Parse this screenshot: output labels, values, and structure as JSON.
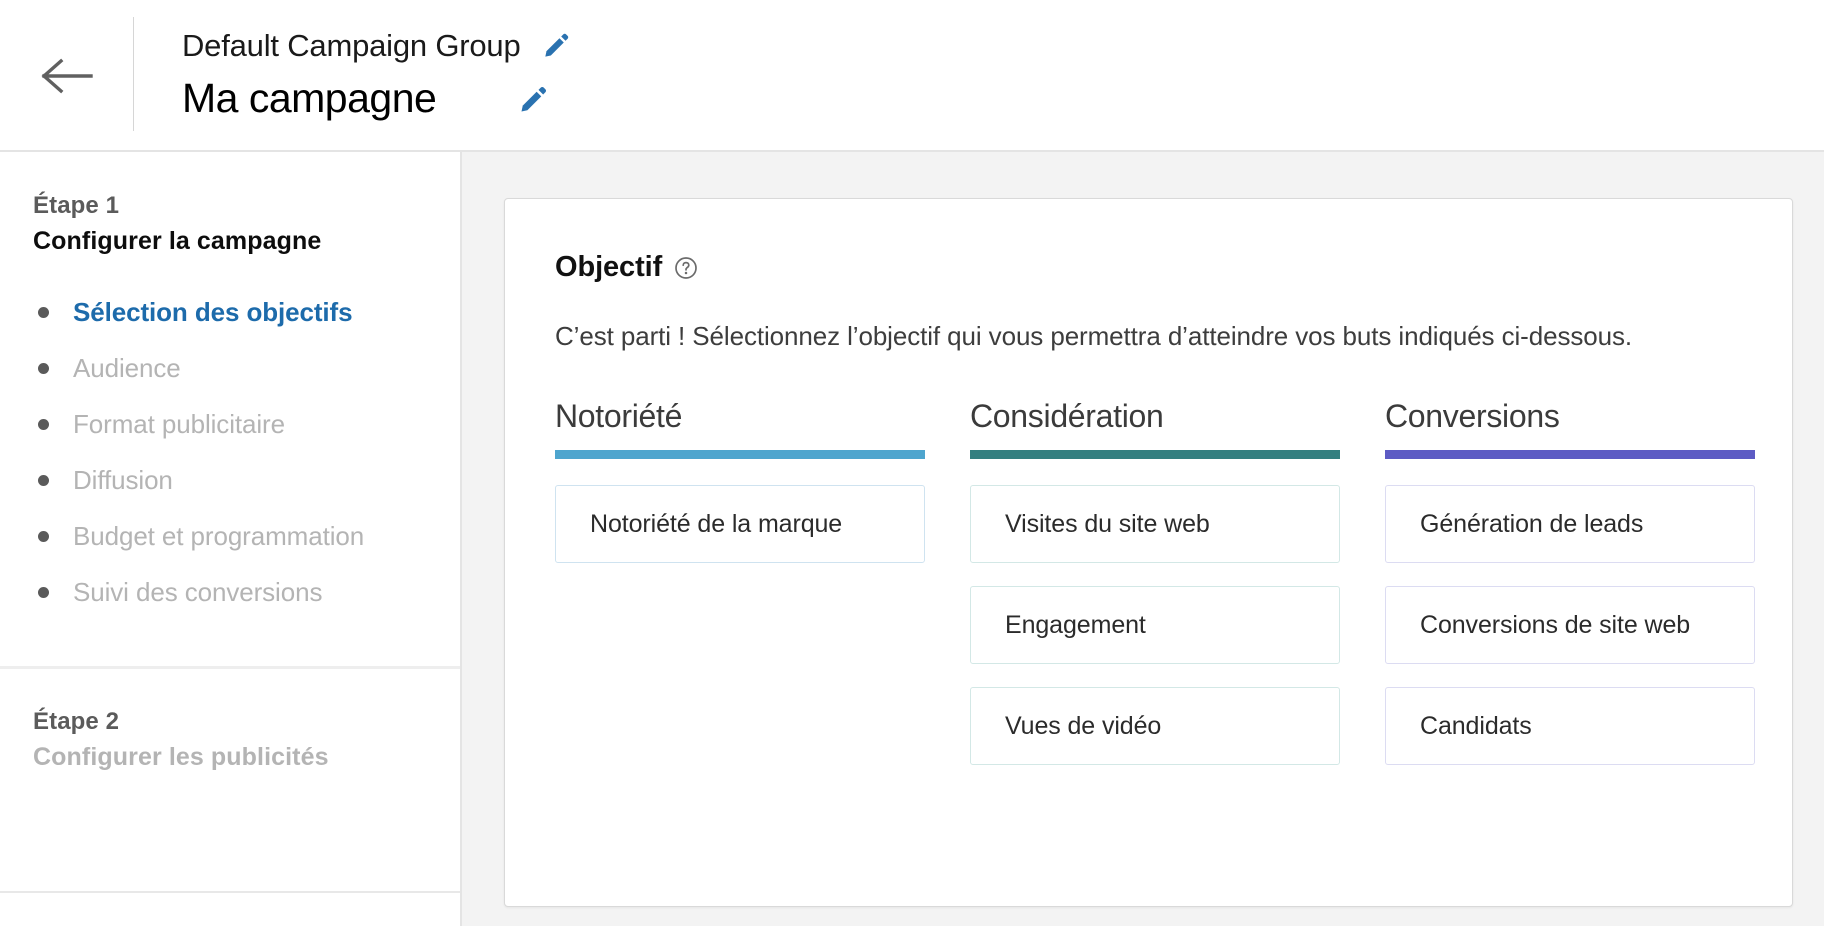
{
  "header": {
    "back_icon": "arrow-left-icon",
    "group_name": "Default Campaign Group",
    "group_edit_icon": "pencil-icon",
    "campaign_name": "Ma campagne",
    "campaign_edit_icon": "pencil-icon",
    "accent_color": "#2a72b0"
  },
  "sidebar": {
    "step1": {
      "label": "Étape 1",
      "title": "Configurer la campagne",
      "substeps": [
        {
          "label": "Sélection des objectifs",
          "active": true
        },
        {
          "label": "Audience",
          "active": false
        },
        {
          "label": "Format publicitaire",
          "active": false
        },
        {
          "label": "Diffusion",
          "active": false
        },
        {
          "label": "Budget et programmation",
          "active": false
        },
        {
          "label": "Suivi des conversions",
          "active": false
        }
      ]
    },
    "step2": {
      "label": "Étape 2",
      "title": "Configurer les publicités"
    },
    "active_color": "#1d6bab",
    "muted_color": "#b4b4b4"
  },
  "main": {
    "card_title": "Objectif",
    "help_icon": "help-circle-icon",
    "description": "C’est parti ! Sélectionnez l’objectif qui vous permettra d’atteindre vos buts indiqués ci-dessous.",
    "columns": [
      {
        "title": "Notoriété",
        "rule_color": "#4ea5ce",
        "border_color": "#cfe3f0",
        "options": [
          {
            "label": "Notoriété de la marque"
          }
        ]
      },
      {
        "title": "Considération",
        "rule_color": "#347f80",
        "border_color": "#d3e8e6",
        "options": [
          {
            "label": "Visites du site web"
          },
          {
            "label": "Engagement"
          },
          {
            "label": "Vues de vidéo"
          }
        ]
      },
      {
        "title": "Conversions",
        "rule_color": "#5d5bc4",
        "border_color": "#dcdcf2",
        "options": [
          {
            "label": "Génération de leads"
          },
          {
            "label": "Conversions de site web"
          },
          {
            "label": "Candidats"
          }
        ]
      }
    ]
  }
}
